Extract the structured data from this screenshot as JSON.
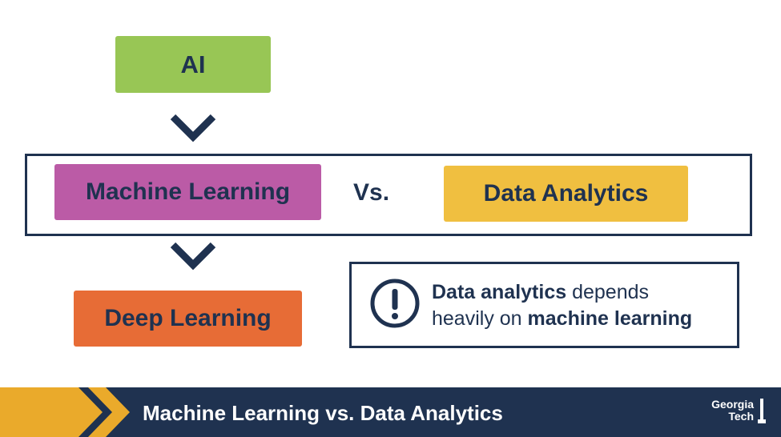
{
  "diagram": {
    "top_node": "AI",
    "middle_left_node": "Machine Learning",
    "comparison_word": "Vs.",
    "middle_right_node": "Data Analytics",
    "bottom_node": "Deep Learning"
  },
  "note": {
    "bold_1": "Data analytics",
    "text_1": " depends",
    "text_2": "heavily on ",
    "bold_2": "machine learning",
    "icon": "exclamation-circle-icon"
  },
  "footer": {
    "title": "Machine Learning vs. Data Analytics",
    "logo_line_1": "Georgia",
    "logo_line_2": "Tech"
  },
  "colors": {
    "navy": "#1f3250",
    "green": "#98c655",
    "magenta": "#bb5ba6",
    "gold": "#f0bf40",
    "orange": "#e76c36",
    "footer_chevron": "#eaaa2b"
  }
}
